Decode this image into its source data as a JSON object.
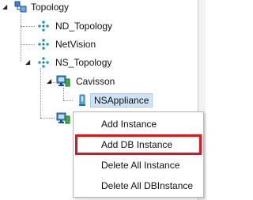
{
  "tree": {
    "root": {
      "label": "Topology",
      "icon": "topology-icon",
      "expanded": true
    },
    "children": [
      {
        "label": "ND_Topology",
        "icon": "network-node-icon"
      },
      {
        "label": "NetVision",
        "icon": "network-node-icon"
      },
      {
        "label": "NS_Topology",
        "icon": "network-node-icon",
        "expanded": true,
        "children": [
          {
            "label": "Cavisson",
            "icon": "server-monitor-icon",
            "expanded": true,
            "children": [
              {
                "label": "NSAppliance",
                "icon": "appliance-icon",
                "selected": true
              }
            ]
          }
        ]
      }
    ]
  },
  "context_menu": {
    "items": [
      {
        "label": "Add Instance"
      },
      {
        "label": "Add DB Instance",
        "highlighted": true
      },
      {
        "label": "Delete All Instance"
      },
      {
        "label": "Delete All DBInstance"
      }
    ],
    "highlight_color": "#e0141e"
  },
  "colors": {
    "selection_background": "#cfe3f6",
    "node_icon": "#2a9bb3"
  }
}
